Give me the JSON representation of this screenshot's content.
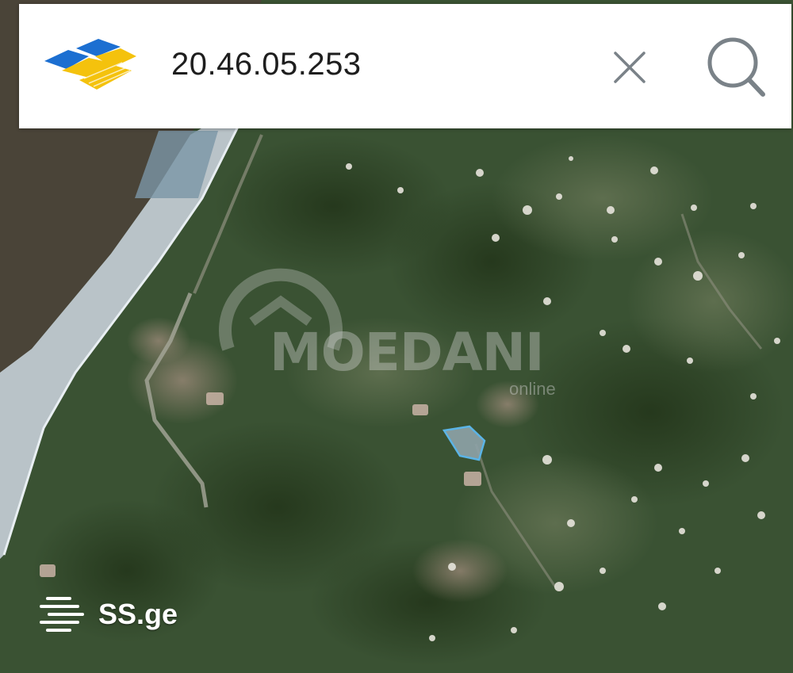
{
  "search": {
    "value": "20.46.05.253"
  },
  "icons": {
    "logo": "napr-logo",
    "clear": "close-icon",
    "search": "search-icon",
    "brand": "menu-lines-icon"
  },
  "map": {
    "view": "satellite",
    "highlighted_parcel": "land-parcel-outline",
    "colors": {
      "sea": "#4a4438",
      "parcel_fill": "#8fa3a8",
      "parcel_stroke": "#5bb4e6",
      "vegetation": "#37502f"
    }
  },
  "watermark": {
    "brand": "MOEDANI",
    "suffix": "online"
  },
  "footer": {
    "brand": "SS.ge"
  },
  "colors": {
    "logo_blue": "#1c6fd1",
    "logo_yellow": "#f4c20d",
    "icon_gray": "#7a8288"
  }
}
